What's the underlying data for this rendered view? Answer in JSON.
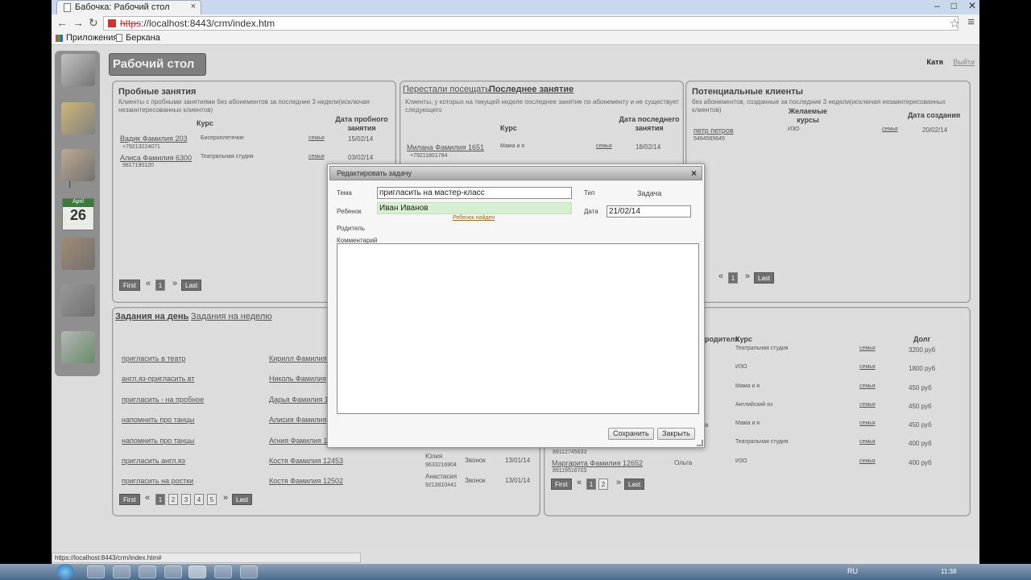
{
  "browser": {
    "tab_title": "Бабочка: Рабочий стол",
    "url_scheme": "https",
    "url_rest": "://localhost:8443/crm/index.htm",
    "bookmarks": [
      "Приложения",
      "Беркана"
    ],
    "status_url": "https://localhost:8443/crm/index.htm#"
  },
  "app": {
    "page_title": "Рабочий стол",
    "user": "Катя",
    "logout": "Выйти",
    "calendar": {
      "month": "April",
      "day": "26"
    }
  },
  "trial": {
    "title": "Пробные занятия",
    "desc": "Клиенты с пробными занятиями без абонементов за последние 3 недели(исключая незаинтересованных клиентов)",
    "col_course": "Курс",
    "col_date": "Дата пробного занятия",
    "rows": [
      {
        "name": "Вадик Фамилия 203",
        "phone": "+79213224071",
        "course": "Бисероплетение",
        "family": "семья",
        "date": "15/02/14"
      },
      {
        "name": "Алиса Фамилия 6300",
        "phone": "9817190120",
        "course": "Театральная студия",
        "family": "семья",
        "date": "03/02/14"
      }
    ],
    "pager": {
      "first": "First",
      "prev": "«",
      "pages": [
        "1"
      ],
      "next": "»",
      "last": "Last"
    }
  },
  "stopped": {
    "tab1": "Перестали посещать",
    "tab2": "Последнее занятие",
    "desc": "Клиенты, у которых на текущей неделе последнее занятие по абонементу и не существует следующего",
    "col_course": "Курс",
    "col_date": "Дата последнего занятия",
    "rows": [
      {
        "name": "Милана Фамилия 1651",
        "phone": "+79211801784",
        "course": "Мама и я",
        "family": "семья",
        "date": "18/02/14"
      }
    ]
  },
  "potential": {
    "title": "Потенциальные клиенты",
    "desc": "без абонементов, созданные за последние 3 недели(исключая незаинтересованных клиентов)",
    "col_course": "Желаемые курсы",
    "col_date": "Дата создания",
    "rows": [
      {
        "name": "петр петров",
        "phone": "5464565645",
        "course": "ИЗО",
        "family": "семья",
        "date": "20/02/14"
      }
    ],
    "pager": {
      "prev": "«",
      "pages": [
        "1"
      ],
      "next": "»",
      "last": "Last"
    }
  },
  "tasks": {
    "tab_day": "Задания на день",
    "tab_week": "Задания на неделю",
    "rows": [
      {
        "task": "пригласить в театр",
        "client": "Кирилл Фамилия"
      },
      {
        "task": "англ.яз-пригласить вт",
        "client": "Николь Фамилия"
      },
      {
        "task": "пригласить - на пробное",
        "client": "Дарья Фамилия 1"
      },
      {
        "task": "напомнить про танцы",
        "client": "Алисия Фамилия"
      },
      {
        "task": "напомнить про танцы",
        "client": "Агния Фамилия 1"
      },
      {
        "task": "пригласить англ.яз",
        "client": "Костя Фамилия 12453",
        "parent": "Юлия",
        "phone": "9633216904",
        "type": "Звонок",
        "date": "13/01/14"
      },
      {
        "task": "пригласить на ростки",
        "client": "Костя Фамилия 12502",
        "parent": "Анастасия",
        "phone": "9213810441",
        "type": "Звонок",
        "date": "13/01/14"
      }
    ],
    "pager": {
      "first": "First",
      "prev": "«",
      "pages": [
        "1",
        "2",
        "3",
        "4",
        "5"
      ],
      "next": "»",
      "last": "Last"
    }
  },
  "debts": {
    "col_parent": "родителя",
    "col_course": "Курс",
    "col_debt": "Долг",
    "rows": [
      {
        "course": "Театральная студия",
        "family": "семья",
        "debt": "3200 руб"
      },
      {
        "course": "ИЗО",
        "family": "семья",
        "debt": "1800 руб"
      },
      {
        "course": "Мама и я",
        "family": "семья",
        "debt": "450 руб"
      },
      {
        "course": "Английский яз",
        "family": "семья",
        "debt": "450 руб"
      },
      {
        "course": "Мама и я",
        "family": "семья",
        "debt": "450 руб",
        "parent": "а"
      },
      {
        "course": "Театральная студия",
        "family": "семья",
        "debt": "400 руб",
        "phone": "89112745633"
      },
      {
        "name": "Маргарита Фамилия 12652",
        "phone": "89119516703",
        "parent": "Ольга",
        "course": "ИЗО",
        "family": "семья",
        "debt": "400 руб"
      }
    ],
    "pager": {
      "first": "First",
      "prev": "«",
      "pages": [
        "1",
        "2"
      ],
      "next": "»",
      "last": "Last"
    }
  },
  "modal": {
    "title": "Редактировать задачу",
    "close": "×",
    "subject_label": "Тема",
    "subject_value": "пригласить на мастер-класс",
    "type_label": "Тип",
    "type_value": "Задача",
    "child_label": "Ребенок",
    "child_value": "Иван Иванов",
    "child_found": "Ребенок найден",
    "date_label": "Дата",
    "date_value": "21/02/14",
    "parent_label": "Родитель",
    "comment_label": "Комментарий",
    "save": "Сохранить",
    "close_btn": "Закрыть"
  },
  "taskbar": {
    "lang": "RU",
    "time": "11:38"
  }
}
